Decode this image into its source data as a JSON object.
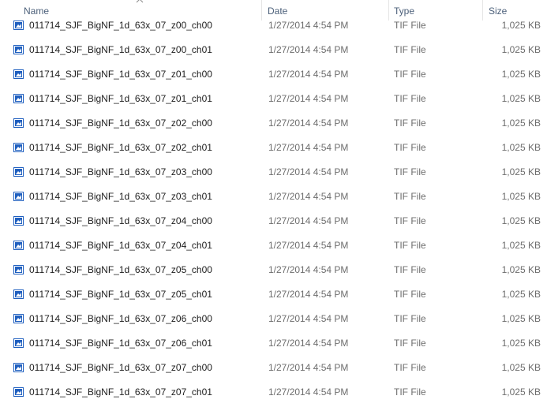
{
  "header": {
    "name": "Name",
    "date": "Date",
    "type": "Type",
    "size": "Size"
  },
  "colors": {
    "header_text": "#4c607a",
    "icon_blue": "#1f5fbf",
    "secondary_text": "#6d6d6d"
  },
  "files": [
    {
      "icon": "tif-image-icon",
      "name": "011714_SJF_BigNF_1d_63x_07_z00_ch00",
      "date": "1/27/2014 4:54 PM",
      "type": "TIF File",
      "size": "1,025 KB"
    },
    {
      "icon": "tif-image-icon",
      "name": "011714_SJF_BigNF_1d_63x_07_z00_ch01",
      "date": "1/27/2014 4:54 PM",
      "type": "TIF File",
      "size": "1,025 KB"
    },
    {
      "icon": "tif-image-icon",
      "name": "011714_SJF_BigNF_1d_63x_07_z01_ch00",
      "date": "1/27/2014 4:54 PM",
      "type": "TIF File",
      "size": "1,025 KB"
    },
    {
      "icon": "tif-image-icon",
      "name": "011714_SJF_BigNF_1d_63x_07_z01_ch01",
      "date": "1/27/2014 4:54 PM",
      "type": "TIF File",
      "size": "1,025 KB"
    },
    {
      "icon": "tif-image-icon",
      "name": "011714_SJF_BigNF_1d_63x_07_z02_ch00",
      "date": "1/27/2014 4:54 PM",
      "type": "TIF File",
      "size": "1,025 KB"
    },
    {
      "icon": "tif-image-icon",
      "name": "011714_SJF_BigNF_1d_63x_07_z02_ch01",
      "date": "1/27/2014 4:54 PM",
      "type": "TIF File",
      "size": "1,025 KB"
    },
    {
      "icon": "tif-image-icon",
      "name": "011714_SJF_BigNF_1d_63x_07_z03_ch00",
      "date": "1/27/2014 4:54 PM",
      "type": "TIF File",
      "size": "1,025 KB"
    },
    {
      "icon": "tif-image-icon",
      "name": "011714_SJF_BigNF_1d_63x_07_z03_ch01",
      "date": "1/27/2014 4:54 PM",
      "type": "TIF File",
      "size": "1,025 KB"
    },
    {
      "icon": "tif-image-icon",
      "name": "011714_SJF_BigNF_1d_63x_07_z04_ch00",
      "date": "1/27/2014 4:54 PM",
      "type": "TIF File",
      "size": "1,025 KB"
    },
    {
      "icon": "tif-image-icon",
      "name": "011714_SJF_BigNF_1d_63x_07_z04_ch01",
      "date": "1/27/2014 4:54 PM",
      "type": "TIF File",
      "size": "1,025 KB"
    },
    {
      "icon": "tif-image-icon",
      "name": "011714_SJF_BigNF_1d_63x_07_z05_ch00",
      "date": "1/27/2014 4:54 PM",
      "type": "TIF File",
      "size": "1,025 KB"
    },
    {
      "icon": "tif-image-icon",
      "name": "011714_SJF_BigNF_1d_63x_07_z05_ch01",
      "date": "1/27/2014 4:54 PM",
      "type": "TIF File",
      "size": "1,025 KB"
    },
    {
      "icon": "tif-image-icon",
      "name": "011714_SJF_BigNF_1d_63x_07_z06_ch00",
      "date": "1/27/2014 4:54 PM",
      "type": "TIF File",
      "size": "1,025 KB"
    },
    {
      "icon": "tif-image-icon",
      "name": "011714_SJF_BigNF_1d_63x_07_z06_ch01",
      "date": "1/27/2014 4:54 PM",
      "type": "TIF File",
      "size": "1,025 KB"
    },
    {
      "icon": "tif-image-icon",
      "name": "011714_SJF_BigNF_1d_63x_07_z07_ch00",
      "date": "1/27/2014 4:54 PM",
      "type": "TIF File",
      "size": "1,025 KB"
    },
    {
      "icon": "tif-image-icon",
      "name": "011714_SJF_BigNF_1d_63x_07_z07_ch01",
      "date": "1/27/2014 4:54 PM",
      "type": "TIF File",
      "size": "1,025 KB"
    }
  ]
}
